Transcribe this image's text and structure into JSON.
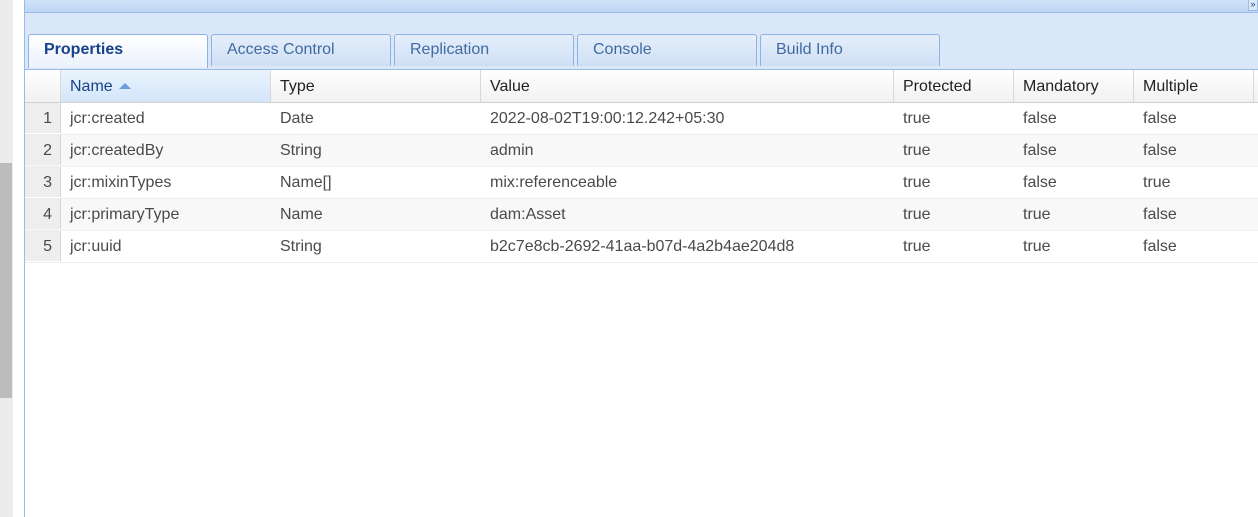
{
  "tabs": [
    {
      "label": "Properties",
      "active": true
    },
    {
      "label": "Access Control",
      "active": false
    },
    {
      "label": "Replication",
      "active": false
    },
    {
      "label": "Console",
      "active": false
    },
    {
      "label": "Build Info",
      "active": false
    }
  ],
  "grid": {
    "columns": [
      "Name",
      "Type",
      "Value",
      "Protected",
      "Mandatory",
      "Multiple"
    ],
    "sorted_column": "Name",
    "sort_direction": "ascending",
    "rows": [
      {
        "num": "1",
        "name": "jcr:created",
        "type": "Date",
        "value": "2022-08-02T19:00:12.242+05:30",
        "protected": "true",
        "mandatory": "false",
        "multiple": "false"
      },
      {
        "num": "2",
        "name": "jcr:createdBy",
        "type": "String",
        "value": "admin",
        "protected": "true",
        "mandatory": "false",
        "multiple": "false"
      },
      {
        "num": "3",
        "name": "jcr:mixinTypes",
        "type": "Name[]",
        "value": "mix:referenceable",
        "protected": "true",
        "mandatory": "false",
        "multiple": "true"
      },
      {
        "num": "4",
        "name": "jcr:primaryType",
        "type": "Name",
        "value": "dam:Asset",
        "protected": "true",
        "mandatory": "true",
        "multiple": "false"
      },
      {
        "num": "5",
        "name": "jcr:uuid",
        "type": "String",
        "value": "b2c7e8cb-2692-41aa-b07d-4a2b4ae204d8",
        "protected": "true",
        "mandatory": "true",
        "multiple": "false"
      }
    ]
  },
  "colors": {
    "accent": "#15428b",
    "tab_border": "#8db2e3",
    "tab_strip": "#d9e7f8"
  }
}
